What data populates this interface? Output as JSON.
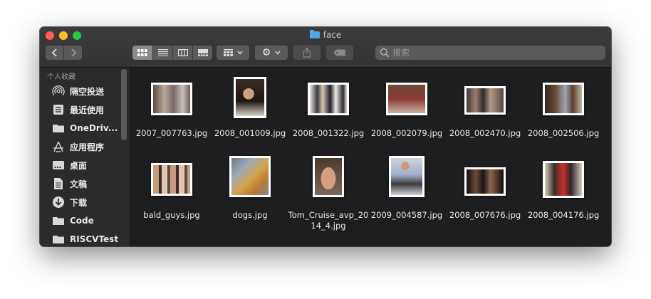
{
  "window": {
    "title": "face",
    "folder_color": "#4fa8e6"
  },
  "toolbar": {
    "back_icon": "chevron-left-icon",
    "forward_icon": "chevron-right-icon",
    "view_modes": [
      "icon-view",
      "list-view",
      "column-view",
      "gallery-view"
    ],
    "active_view": "icon-view",
    "search_placeholder": "搜索"
  },
  "sidebar": {
    "section_title": "个人收藏",
    "items": [
      {
        "label": "隔空投送",
        "icon": "airdrop-icon"
      },
      {
        "label": "最近使用",
        "icon": "recents-icon"
      },
      {
        "label": "OneDriv...",
        "icon": "folder-icon"
      },
      {
        "label": "应用程序",
        "icon": "applications-icon"
      },
      {
        "label": "桌面",
        "icon": "desktop-icon"
      },
      {
        "label": "文稿",
        "icon": "document-icon"
      },
      {
        "label": "下载",
        "icon": "download-icon"
      },
      {
        "label": "Code",
        "icon": "folder-icon"
      },
      {
        "label": "RISCVTest",
        "icon": "folder-icon"
      }
    ]
  },
  "files": [
    {
      "name": "2007_007763.jpg"
    },
    {
      "name": "2008_001009.jpg"
    },
    {
      "name": "2008_001322.jpg"
    },
    {
      "name": "2008_002079.jpg"
    },
    {
      "name": "2008_002470.jpg"
    },
    {
      "name": "2008_002506.jpg"
    },
    {
      "name": "bald_guys.jpg"
    },
    {
      "name": "dogs.jpg"
    },
    {
      "name": "Tom_Cruise_avp_2014_4.jpg"
    },
    {
      "name": "2009_004587.jpg"
    },
    {
      "name": "2008_007676.jpg"
    },
    {
      "name": "2008_004176.jpg"
    }
  ]
}
